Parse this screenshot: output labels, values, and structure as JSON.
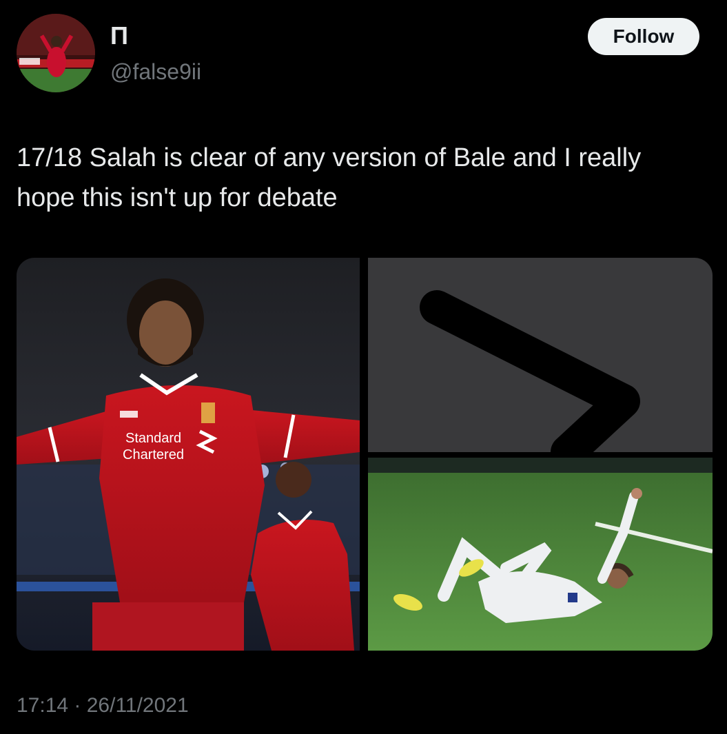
{
  "tweet": {
    "display_name": "Π",
    "handle": "@false9ii",
    "follow_label": "Follow",
    "text": "17/18 Salah is clear of any version of Bale and I really hope this isn't up for debate",
    "timestamp": "17:14 · 26/11/2021"
  },
  "media": {
    "left_image": "photo-liverpool-player-celebrating",
    "left_sponsor_line1": "Standard",
    "left_sponsor_line2": "Chartered",
    "top_right_image": "greater-than-symbol-graphic",
    "bottom_right_image": "photo-real-madrid-player-on-grass"
  },
  "colors": {
    "background": "#000000",
    "primary_text": "#e7e9ea",
    "secondary_text": "#71767b",
    "follow_bg": "#eff3f4",
    "follow_text": "#0f1419",
    "liverpool_red": "#c8102e",
    "grey_panel": "#39393b",
    "pitch_green": "#4f8a3a"
  }
}
